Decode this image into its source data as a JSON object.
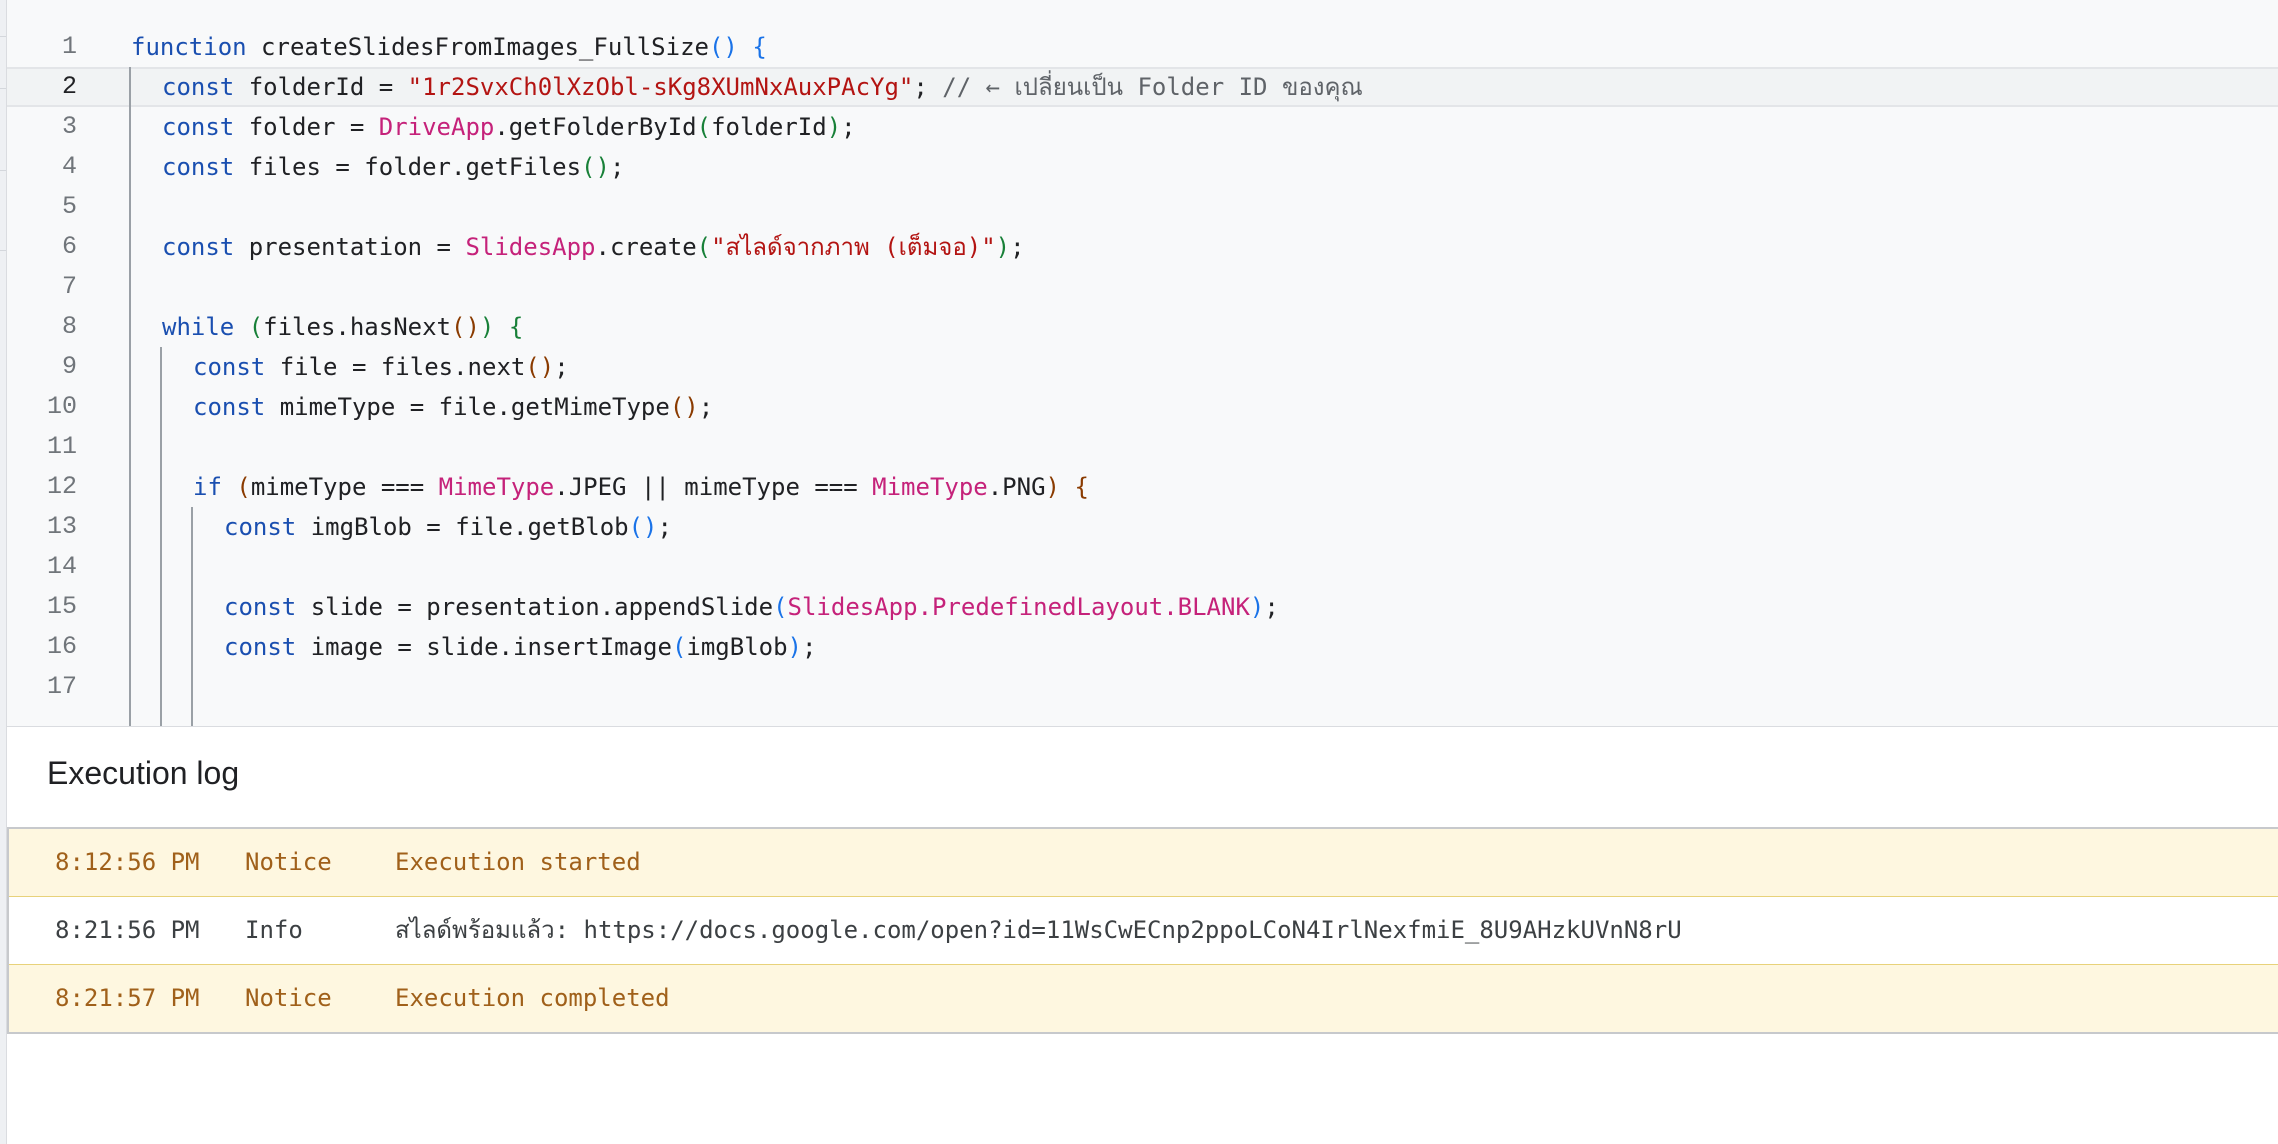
{
  "editor": {
    "current_line": 2,
    "lines": [
      {
        "n": "1",
        "indent": 0,
        "segs": [
          [
            "kw",
            "function"
          ],
          [
            "",
            "createSlidesFromImages_FullSize"
          ],
          [
            "p1",
            "()"
          ],
          [
            "",
            ""
          ],
          [
            "p1",
            "{"
          ]
        ]
      },
      {
        "n": "2",
        "indent": 1,
        "segs": [
          [
            "kw",
            "const"
          ],
          [
            "",
            "folderId = "
          ],
          [
            "str",
            "\"1r2SvxCh0lXzObl-sKg8XUmNxAuxPAcYg\""
          ],
          [
            "",
            ";"
          ],
          [
            "cm",
            "// ← เปลี่ยนเป็น Folder ID ของคุณ"
          ]
        ]
      },
      {
        "n": "3",
        "indent": 1,
        "segs": [
          [
            "kw",
            "const"
          ],
          [
            "",
            "folder = "
          ],
          [
            "cls",
            "DriveApp"
          ],
          [
            "",
            ".getFolderById"
          ],
          [
            "p2",
            "("
          ],
          [
            "",
            "folderId"
          ],
          [
            "p2",
            ")"
          ],
          [
            "",
            ";"
          ]
        ]
      },
      {
        "n": "4",
        "indent": 1,
        "segs": [
          [
            "kw",
            "const"
          ],
          [
            "",
            "files = folder.getFiles"
          ],
          [
            "p2",
            "()"
          ],
          [
            "",
            ";"
          ]
        ]
      },
      {
        "n": "5",
        "indent": 1,
        "segs": []
      },
      {
        "n": "6",
        "indent": 1,
        "segs": [
          [
            "kw",
            "const"
          ],
          [
            "",
            "presentation = "
          ],
          [
            "cls",
            "SlidesApp"
          ],
          [
            "",
            ".create"
          ],
          [
            "p2",
            "("
          ],
          [
            "str",
            "\"สไลด์จากภาพ (เต็มจอ)\""
          ],
          [
            "p2",
            ")"
          ],
          [
            "",
            ";"
          ]
        ]
      },
      {
        "n": "7",
        "indent": 1,
        "segs": []
      },
      {
        "n": "8",
        "indent": 1,
        "segs": [
          [
            "kw",
            "while"
          ],
          [
            "p2",
            "("
          ],
          [
            "",
            "files.hasNext"
          ],
          [
            "p3",
            "()"
          ],
          [
            "p2",
            ")"
          ],
          [
            "p2",
            "{"
          ]
        ]
      },
      {
        "n": "9",
        "indent": 2,
        "segs": [
          [
            "kw",
            "const"
          ],
          [
            "",
            "file = files.next"
          ],
          [
            "p3",
            "()"
          ],
          [
            "",
            ";"
          ]
        ]
      },
      {
        "n": "10",
        "indent": 2,
        "segs": [
          [
            "kw",
            "const"
          ],
          [
            "",
            "mimeType = file.getMimeType"
          ],
          [
            "p3",
            "()"
          ],
          [
            "",
            ";"
          ]
        ]
      },
      {
        "n": "11",
        "indent": 2,
        "segs": []
      },
      {
        "n": "12",
        "indent": 2,
        "segs": [
          [
            "kw",
            "if"
          ],
          [
            "p3",
            "("
          ],
          [
            "",
            "mimeType === "
          ],
          [
            "cls",
            "MimeType"
          ],
          [
            "",
            ".JPEG"
          ],
          [
            "",
            " || mimeType === "
          ],
          [
            "cls",
            "MimeType"
          ],
          [
            "",
            ".PNG"
          ],
          [
            "p3",
            ")"
          ],
          [
            "p3",
            "{"
          ]
        ]
      },
      {
        "n": "13",
        "indent": 3,
        "segs": [
          [
            "kw",
            "const"
          ],
          [
            "",
            "imgBlob = file.getBlob"
          ],
          [
            "p1",
            "()"
          ],
          [
            "",
            ";"
          ]
        ]
      },
      {
        "n": "14",
        "indent": 3,
        "segs": []
      },
      {
        "n": "15",
        "indent": 3,
        "segs": [
          [
            "kw",
            "const"
          ],
          [
            "",
            "slide = presentation.appendSlide"
          ],
          [
            "p1",
            "("
          ],
          [
            "cls",
            "SlidesApp.PredefinedLayout.BLANK"
          ],
          [
            "p1",
            ")"
          ],
          [
            "",
            ";"
          ]
        ]
      },
      {
        "n": "16",
        "indent": 3,
        "segs": [
          [
            "kw",
            "const"
          ],
          [
            "",
            "image = slide.insertImage"
          ],
          [
            "p1",
            "("
          ],
          [
            "",
            "imgBlob"
          ],
          [
            "p1",
            ")"
          ],
          [
            "",
            ";"
          ]
        ]
      },
      {
        "n": "17",
        "indent": 3,
        "segs": []
      }
    ]
  },
  "log": {
    "title": "Execution log",
    "rows": [
      {
        "time": "8:12:56 PM",
        "level": "Notice",
        "message": "Execution started"
      },
      {
        "time": "8:21:56 PM",
        "level": "Info",
        "message": "สไลด์พร้อมแล้ว: https://docs.google.com/open?id=11WsCwECnp2ppoLCoN4IrlNexfmiE_8U9AHzkUVnN8rU"
      },
      {
        "time": "8:21:57 PM",
        "level": "Notice",
        "message": "Execution completed"
      }
    ]
  }
}
